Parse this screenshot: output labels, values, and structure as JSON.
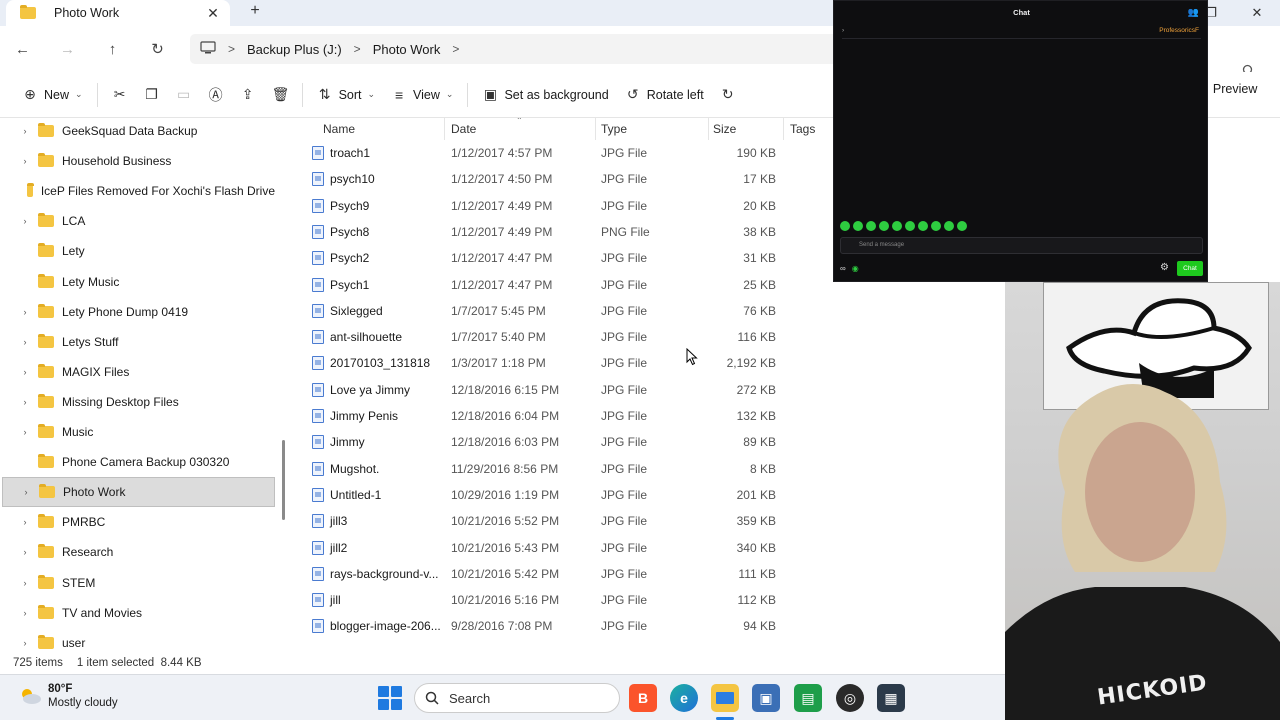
{
  "window": {
    "tab_title": "Photo Work",
    "close_glyph": "✕",
    "newtab_glyph": "+"
  },
  "breadcrumb": [
    "Backup Plus (J:)",
    "Photo Work"
  ],
  "toolbar": {
    "new": "New",
    "sort": "Sort",
    "view": "View",
    "set_background": "Set as background",
    "rotate_left": "Rotate left",
    "preview": "Preview"
  },
  "sidebar": {
    "items": [
      {
        "label": "GeekSquad Data Backup",
        "expandable": true
      },
      {
        "label": "Household Business",
        "expandable": true
      },
      {
        "label": "IceP Files Removed For Xochi's Flash Drive",
        "expandable": false
      },
      {
        "label": "LCA",
        "expandable": true
      },
      {
        "label": "Lety",
        "expandable": false
      },
      {
        "label": "Lety Music",
        "expandable": false
      },
      {
        "label": "Lety Phone Dump 0419",
        "expandable": true
      },
      {
        "label": "Letys Stuff",
        "expandable": true
      },
      {
        "label": "MAGIX Files",
        "expandable": true
      },
      {
        "label": "Missing Desktop Files",
        "expandable": true
      },
      {
        "label": "Music",
        "expandable": true
      },
      {
        "label": "Phone Camera Backup 030320",
        "expandable": false
      },
      {
        "label": "Photo Work",
        "expandable": true,
        "selected": true
      },
      {
        "label": "PMRBC",
        "expandable": true
      },
      {
        "label": "Research",
        "expandable": true
      },
      {
        "label": "STEM",
        "expandable": true
      },
      {
        "label": "TV and Movies",
        "expandable": true
      },
      {
        "label": "user",
        "expandable": true
      }
    ]
  },
  "filelist": {
    "columns": [
      "Name",
      "Date",
      "Type",
      "Size",
      "Tags"
    ],
    "rows": [
      {
        "name": "troach1",
        "date": "1/12/2017 4:57 PM",
        "type": "JPG File",
        "size": "190 KB"
      },
      {
        "name": "psych10",
        "date": "1/12/2017 4:50 PM",
        "type": "JPG File",
        "size": "17 KB"
      },
      {
        "name": "Psych9",
        "date": "1/12/2017 4:49 PM",
        "type": "JPG File",
        "size": "20 KB"
      },
      {
        "name": "Psych8",
        "date": "1/12/2017 4:49 PM",
        "type": "PNG File",
        "size": "38 KB"
      },
      {
        "name": "Psych2",
        "date": "1/12/2017 4:47 PM",
        "type": "JPG File",
        "size": "31 KB"
      },
      {
        "name": "Psych1",
        "date": "1/12/2017 4:47 PM",
        "type": "JPG File",
        "size": "25 KB"
      },
      {
        "name": "Sixlegged",
        "date": "1/7/2017 5:45 PM",
        "type": "JPG File",
        "size": "76 KB"
      },
      {
        "name": "ant-silhouette",
        "date": "1/7/2017 5:40 PM",
        "type": "JPG File",
        "size": "116 KB"
      },
      {
        "name": "20170103_131818",
        "date": "1/3/2017 1:18 PM",
        "type": "JPG File",
        "size": "2,192 KB"
      },
      {
        "name": "Love ya Jimmy",
        "date": "12/18/2016 6:15 PM",
        "type": "JPG File",
        "size": "272 KB"
      },
      {
        "name": "Jimmy Penis",
        "date": "12/18/2016 6:04 PM",
        "type": "JPG File",
        "size": "132 KB"
      },
      {
        "name": "Jimmy",
        "date": "12/18/2016 6:03 PM",
        "type": "JPG File",
        "size": "89 KB"
      },
      {
        "name": "Mugshot.",
        "date": "11/29/2016 8:56 PM",
        "type": "JPG File",
        "size": "8 KB"
      },
      {
        "name": "Untitled-1",
        "date": "10/29/2016 1:19 PM",
        "type": "JPG File",
        "size": "201 KB"
      },
      {
        "name": "jill3",
        "date": "10/21/2016 5:52 PM",
        "type": "JPG File",
        "size": "359 KB"
      },
      {
        "name": "jill2",
        "date": "10/21/2016 5:43 PM",
        "type": "JPG File",
        "size": "340 KB"
      },
      {
        "name": "rays-background-v...",
        "date": "10/21/2016 5:42 PM",
        "type": "JPG File",
        "size": "111 KB"
      },
      {
        "name": "jill",
        "date": "10/21/2016 5:16 PM",
        "type": "JPG File",
        "size": "112 KB"
      },
      {
        "name": "blogger-image-206...",
        "date": "9/28/2016 7:08 PM",
        "type": "JPG File",
        "size": "94 KB"
      }
    ]
  },
  "status": {
    "items": "725 items",
    "selected": "1 item selected  8.44 KB"
  },
  "chat": {
    "title": "Chat",
    "badge": "ProfessoricsF",
    "placeholder": "Send a message",
    "button": "Chat"
  },
  "webcam": {
    "shirt_text": "HICKOID"
  },
  "taskbar": {
    "temp": "80°F",
    "condition": "Mostly cloudy",
    "search": "Search"
  },
  "colors": {
    "accent": "#1f7ae0",
    "folder": "#f4c542",
    "chat_green": "#1ec91e"
  }
}
